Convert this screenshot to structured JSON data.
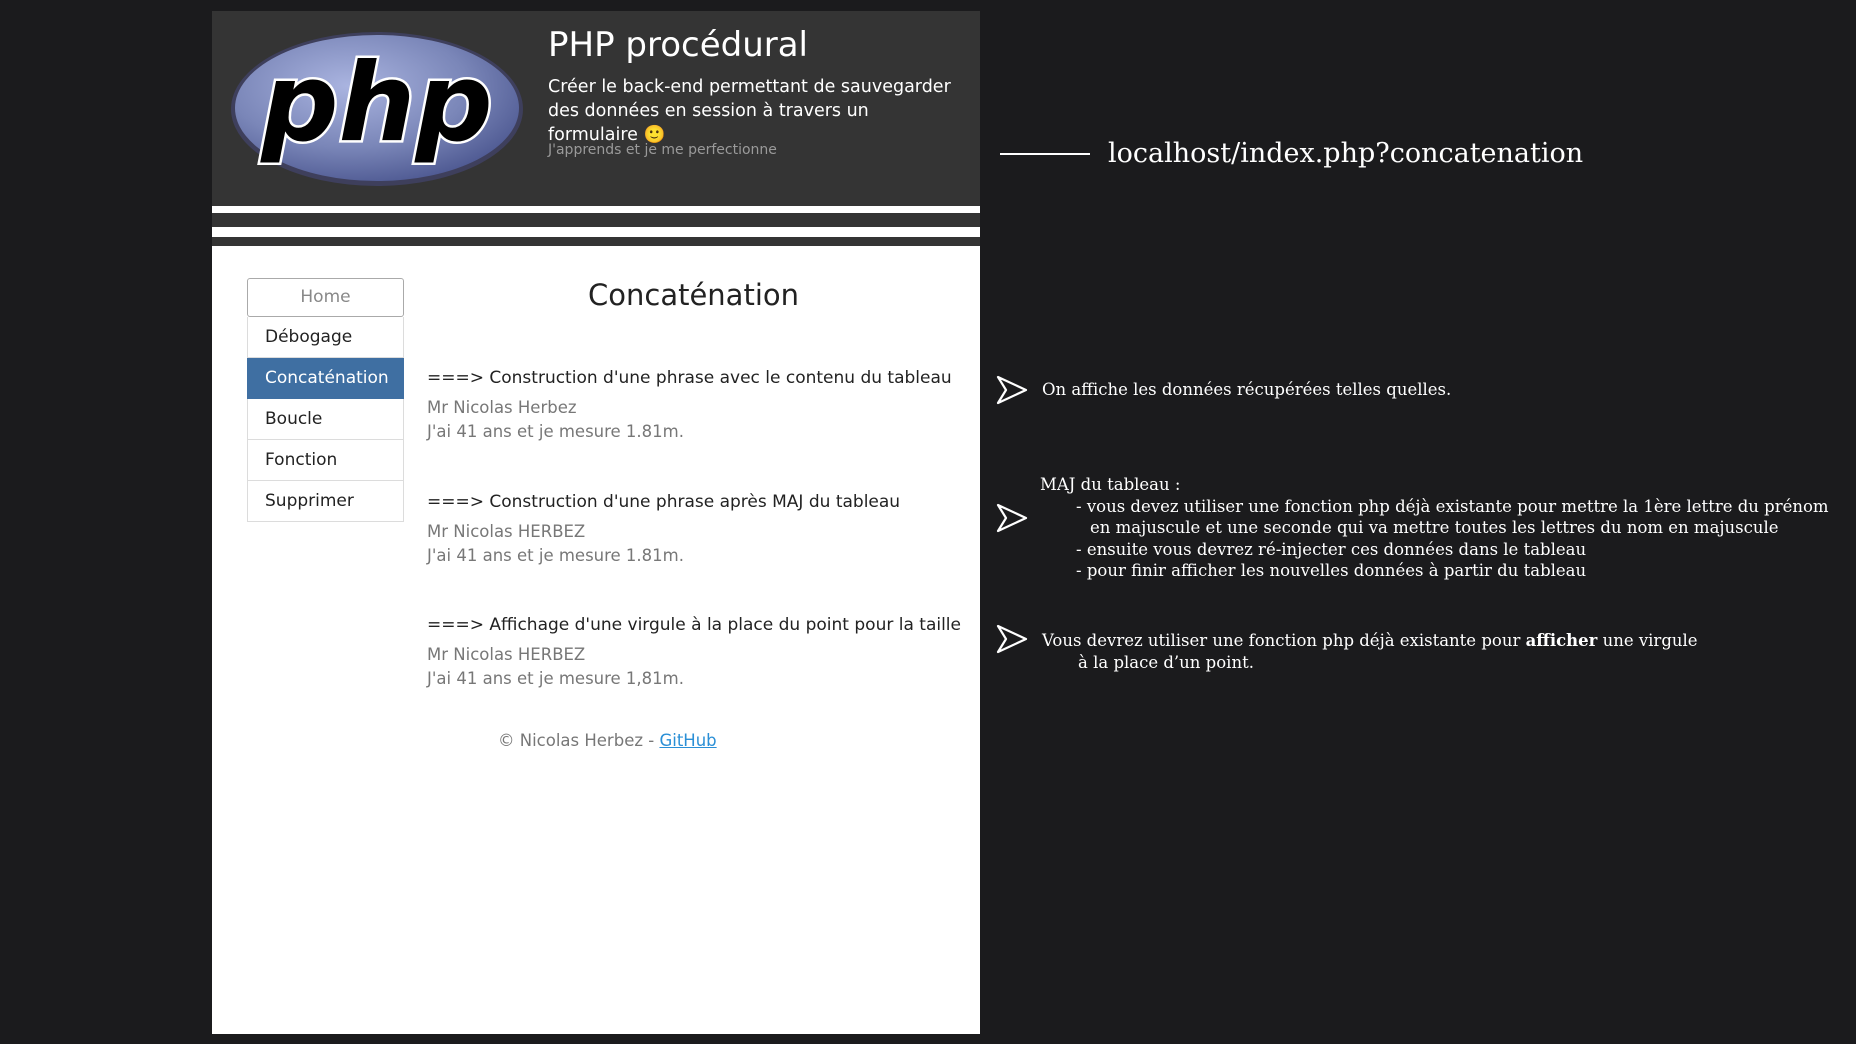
{
  "header": {
    "title": "PHP procédural",
    "description": "Créer le back-end permettant de sauvegarder des données en session à travers un formulaire 🙂",
    "motto": "J'apprends et je me perfectionne",
    "logo_text": "php"
  },
  "sidebar": {
    "items": [
      {
        "label": "Home"
      },
      {
        "label": "Débogage"
      },
      {
        "label": "Concaténation"
      },
      {
        "label": "Boucle"
      },
      {
        "label": "Fonction"
      },
      {
        "label": "Supprimer"
      }
    ],
    "active": "Concaténation"
  },
  "main": {
    "title": "Concaténation",
    "sections": [
      {
        "heading": "===> Construction d'une phrase avec le contenu du tableau",
        "line1": "Mr Nicolas Herbez",
        "line2": "J'ai 41 ans et je mesure 1.81m."
      },
      {
        "heading": "===> Construction d'une phrase après MAJ du tableau",
        "line1": "Mr Nicolas HERBEZ",
        "line2": "J'ai 41 ans et je mesure 1.81m."
      },
      {
        "heading": "===> Affichage d'une virgule à la place du point pour la taille",
        "line1": "Mr Nicolas HERBEZ",
        "line2": "J'ai 41 ans et je mesure 1,81m."
      }
    ],
    "footer": {
      "copyright": "© Nicolas Herbez - ",
      "link": "GitHub"
    }
  },
  "annotations": {
    "url": "localhost/index.php?concatenation",
    "note1": "On affiche les données récupérées telles quelles.",
    "note2": {
      "title": "MAJ du tableau :",
      "line1": "- vous devez utiliser une fonction php déjà existante pour mettre la 1ère lettre du prénom",
      "line2": "en majuscule et une seconde qui va mettre toutes les lettres du nom en majuscule",
      "line3": "- ensuite vous devrez ré-injecter ces données dans le tableau",
      "line4": "- pour finir afficher les nouvelles données à partir du tableau"
    },
    "note3": {
      "before": "Vous devrez utiliser une fonction php déjà existante pour ",
      "bold": "afficher",
      "after": " une virgule",
      "line2": "à la place d’un point."
    }
  },
  "colors": {
    "background": "#1b1b1d",
    "header": "#343434",
    "active_nav": "#3f6fa2",
    "link": "#2a8fd6",
    "php_logo": "#7a86b8"
  },
  "icons": [
    "php-logo",
    "arrow-icon"
  ]
}
